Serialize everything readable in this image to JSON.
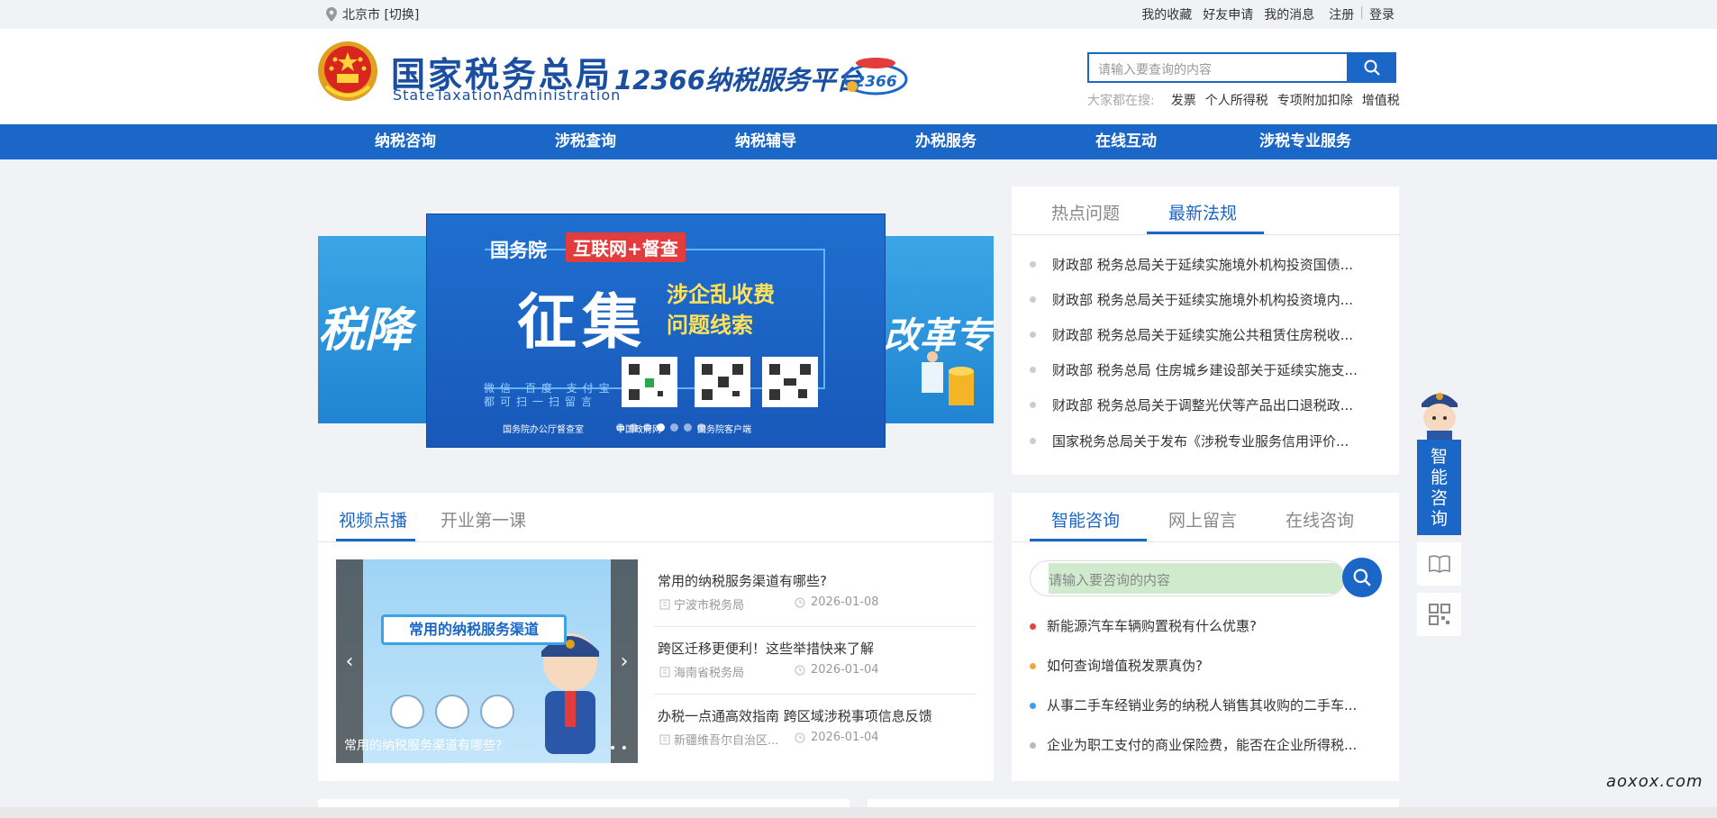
{
  "topbar": {
    "location": "北京市 [切换]",
    "links": [
      "我的收藏",
      "好友申请",
      "我的消息",
      "注册",
      "登录"
    ]
  },
  "header": {
    "logo_cn": "国家税务总局",
    "logo_en": "StateTaxationAdministration",
    "platform": "12366纳税服务平台",
    "search_placeholder": "请输入要查询的内容",
    "hot_label": "大家都在搜:",
    "hot_words": [
      "发票",
      "个人所得税",
      "专项附加扣除",
      "增值税"
    ]
  },
  "nav": [
    "纳税咨询",
    "涉税查询",
    "纳税辅导",
    "办税服务",
    "在线互动",
    "涉税专业服务"
  ],
  "banner": {
    "left_text": "税降",
    "right_text": "改革专",
    "line1": "国务院",
    "line1_badge": "互联网+督查",
    "big": "征集",
    "sub1": "涉企乱收费",
    "sub2": "问题线索",
    "small1": "微信 百度 支付宝",
    "small2": "都可扫一扫留言",
    "foot1": "国务院办公厅督查室",
    "foot2": "中国政府网",
    "foot3": "国务院客户端"
  },
  "hot_panel": {
    "tabs": [
      "热点问题",
      "最新法规"
    ],
    "active_tab": 1,
    "items": [
      "财政部 税务总局关于延续实施境外机构投资国债...",
      "财政部 税务总局关于延续实施境外机构投资境内...",
      "财政部 税务总局关于延续实施公共租赁住房税收...",
      "财政部 税务总局 住房城乡建设部关于延续实施支...",
      "财政部 税务总局关于调整光伏等产品出口退税政...",
      "国家税务总局关于发布《涉税专业服务信用评价..."
    ]
  },
  "video_panel": {
    "tabs": [
      "视频点播",
      "开业第一课"
    ],
    "active_tab": 0,
    "video_title": "常用的纳税服务渠道",
    "video_caption": "常用的纳税服务渠道有哪些?",
    "news": [
      {
        "title": "常用的纳税服务渠道有哪些?",
        "source": "宁波市税务局",
        "date": "2026-01-08"
      },
      {
        "title": "跨区迁移更便利！这些举措快来了解",
        "source": "海南省税务局",
        "date": "2026-01-04"
      },
      {
        "title": "办税一点通高效指南 跨区域涉税事项信息反馈",
        "source": "新疆维吾尔自治区...",
        "date": "2026-01-04"
      }
    ]
  },
  "consult_panel": {
    "tabs": [
      "智能咨询",
      "网上留言",
      "在线咨询"
    ],
    "active_tab": 0,
    "placeholder": "请输入要咨询的内容",
    "questions": [
      {
        "text": "新能源汽车车辆购置税有什么优惠?",
        "color": "#e8423a"
      },
      {
        "text": "如何查询增值税发票真伪?",
        "color": "#f0a73a"
      },
      {
        "text": "从事二手车经销业务的纳税人销售其收购的二手车...",
        "color": "#3aa0e8"
      },
      {
        "text": "企业为职工支付的商业保险费，能否在企业所得税...",
        "color": "#bbbbbb"
      }
    ]
  },
  "side": {
    "consult_label": "智能咨询"
  },
  "watermark": "aoxox.com",
  "colors": {
    "primary": "#1a67c7",
    "logo": "#1a4ea0",
    "background": "#f1f2f5"
  }
}
